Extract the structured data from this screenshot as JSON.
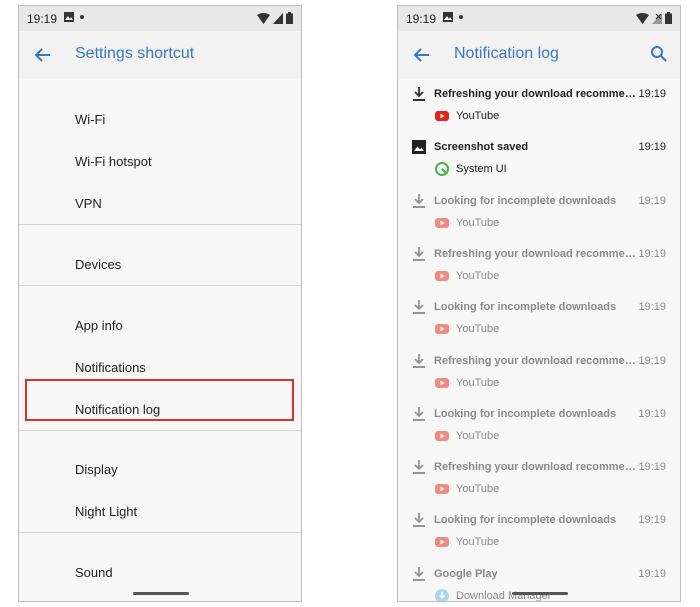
{
  "left_phone": {
    "status": {
      "time": "19:19"
    },
    "title": "Settings shortcut",
    "items": [
      {
        "label": "Wi-Fi"
      },
      {
        "label": "Wi-Fi hotspot"
      },
      {
        "label": "VPN"
      },
      {
        "label": "Devices"
      },
      {
        "label": "App info"
      },
      {
        "label": "Notifications"
      },
      {
        "label": "Notification log"
      },
      {
        "label": "Display"
      },
      {
        "label": "Night Light"
      },
      {
        "label": "Sound"
      }
    ],
    "highlight_color": "#d9322a"
  },
  "right_phone": {
    "status": {
      "time": "19:19"
    },
    "title": "Notification log",
    "entries": [
      {
        "title": "Refreshing your download recommenda...",
        "time": "19:19",
        "app": "YouTube",
        "icon": "download-icon",
        "app_icon": "youtube-icon",
        "dim": false
      },
      {
        "title": "Screenshot saved",
        "time": "19:19",
        "app": "System UI",
        "icon": "image-icon",
        "app_icon": "system-ui-icon",
        "dim": false
      },
      {
        "title": "Looking for incomplete downloads",
        "time": "19:19",
        "app": "YouTube",
        "icon": "download-icon",
        "app_icon": "youtube-icon",
        "dim": true
      },
      {
        "title": "Refreshing your download recommenda...",
        "time": "19:19",
        "app": "YouTube",
        "icon": "download-icon",
        "app_icon": "youtube-icon",
        "dim": true
      },
      {
        "title": "Looking for incomplete downloads",
        "time": "19:19",
        "app": "YouTube",
        "icon": "download-icon",
        "app_icon": "youtube-icon",
        "dim": true
      },
      {
        "title": "Refreshing your download recommenda...",
        "time": "19:19",
        "app": "YouTube",
        "icon": "download-icon",
        "app_icon": "youtube-icon",
        "dim": true
      },
      {
        "title": "Looking for incomplete downloads",
        "time": "19:19",
        "app": "YouTube",
        "icon": "download-icon",
        "app_icon": "youtube-icon",
        "dim": true
      },
      {
        "title": "Refreshing your download recommenda...",
        "time": "19:19",
        "app": "YouTube",
        "icon": "download-icon",
        "app_icon": "youtube-icon",
        "dim": true
      },
      {
        "title": "Looking for incomplete downloads",
        "time": "19:19",
        "app": "YouTube",
        "icon": "download-icon",
        "app_icon": "youtube-icon",
        "dim": true
      },
      {
        "title": "Google Play",
        "time": "19:19",
        "app": "Download Manager",
        "icon": "download-icon",
        "app_icon": "download-manager-icon",
        "dim": true
      }
    ]
  },
  "colors": {
    "accent": "#3a78c3",
    "youtube": "#e62117",
    "system_ui": "#4caf50",
    "download_manager": "#5fb7e8"
  }
}
